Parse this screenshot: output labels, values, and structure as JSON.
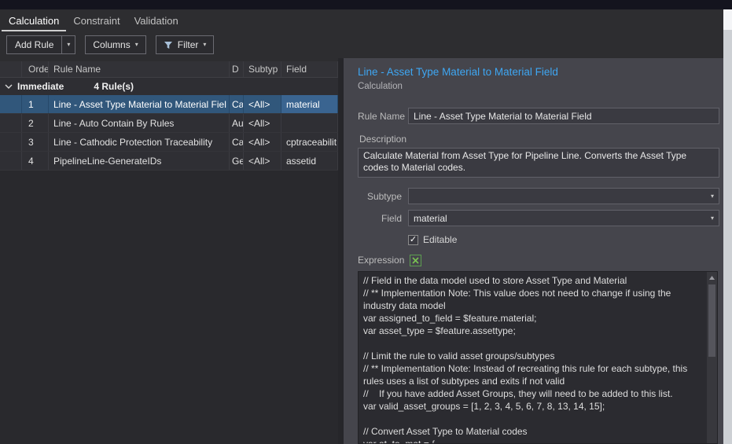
{
  "tabs": [
    {
      "label": "Calculation",
      "active": true
    },
    {
      "label": "Constraint",
      "active": false
    },
    {
      "label": "Validation",
      "active": false
    }
  ],
  "toolbar": {
    "add_rule": "Add Rule",
    "columns": "Columns",
    "filter": "Filter"
  },
  "icons": {
    "dropdown_caret": "▾",
    "check": "✓"
  },
  "table": {
    "headers": [
      "",
      "Orde",
      "Rule Name",
      "D",
      "Subtyp",
      "Field"
    ],
    "group": {
      "label": "Immediate",
      "count": "4 Rule(s)"
    },
    "rows": [
      {
        "order": "1",
        "name": "Line - Asset Type Material to Material Fiel",
        "d": "Ca",
        "subtype": "<All>",
        "field": "material",
        "selected": true
      },
      {
        "order": "2",
        "name": "Line - Auto Contain By Rules",
        "d": "Au",
        "subtype": "<All>",
        "field": "",
        "selected": false
      },
      {
        "order": "3",
        "name": "Line - Cathodic Protection Traceability",
        "d": "Ca",
        "subtype": "<All>",
        "field": "cptraceabilit",
        "selected": false
      },
      {
        "order": "4",
        "name": "PipelineLine-GenerateIDs",
        "d": "Ge",
        "subtype": "<All>",
        "field": "assetid",
        "selected": false
      }
    ]
  },
  "details": {
    "title": "Line - Asset Type Material to Material Field",
    "subtitle": "Calculation",
    "rule_name_label": "Rule Name",
    "rule_name_value": "Line - Asset Type Material to Material Field",
    "description_label": "Description",
    "description_value": "Calculate Material from Asset Type for Pipeline Line. Converts the Asset Type codes to Material codes.",
    "subtype_label": "Subtype",
    "subtype_value": "",
    "field_label": "Field",
    "field_value": "material",
    "editable_checked": true,
    "editable_label": "Editable",
    "expression_label": "Expression",
    "code_lines": [
      "// Field in the data model used to store Asset Type and Material",
      "// ** Implementation Note: This value does not need to change if using the",
      "industry data model",
      "var assigned_to_field = $feature.material;",
      "var asset_type = $feature.assettype;",
      "",
      "// Limit the rule to valid asset groups/subtypes",
      "// ** Implementation Note: Instead of recreating this rule for each subtype, this",
      "rules uses a list of subtypes and exits if not valid",
      "//    If you have added Asset Groups, they will need to be added to this list.",
      "var valid_asset_groups = [1, 2, 3, 4, 5, 6, 7, 8, 13, 14, 15];",
      "",
      "// Convert Asset Type to Material codes",
      "var at_to_mat = {"
    ]
  },
  "colors": {
    "accent_blue": "#3ea6f2",
    "selection_blue": "#31577b",
    "panel_gray": "#45454c",
    "arcade_green": "#79c352"
  }
}
